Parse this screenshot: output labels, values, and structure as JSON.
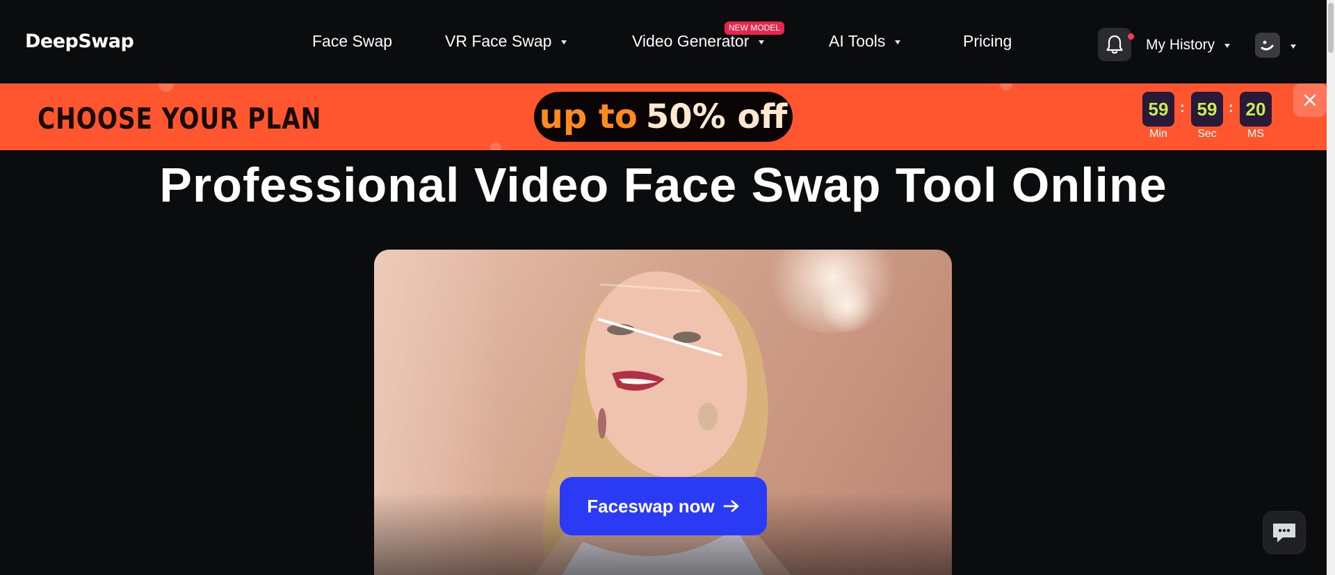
{
  "header": {
    "logo": "DeepSwap",
    "nav": [
      {
        "label": "Face Swap",
        "has_dropdown": false
      },
      {
        "label": "VR Face Swap",
        "has_dropdown": true
      },
      {
        "label": "Video Generator",
        "has_dropdown": true,
        "badge": "NEW MODEL"
      },
      {
        "label": "AI Tools",
        "has_dropdown": true
      },
      {
        "label": "Pricing",
        "has_dropdown": false
      }
    ],
    "notifications_icon": "bell-icon",
    "history_label": "My History",
    "avatar_icon": "avatar-icon"
  },
  "banner": {
    "headline": "CHOOSE YOUR PLAN",
    "offer_prefix": "up to",
    "offer_value": "50% off",
    "timer": [
      {
        "value": "59",
        "label": "Min"
      },
      {
        "value": "59",
        "label": "Sec"
      },
      {
        "value": "20",
        "label": "MS"
      }
    ],
    "close_icon": "close-icon"
  },
  "hero": {
    "title": "Professional Video Face Swap Tool Online",
    "cta_label": "Faceswap now",
    "cta_icon": "arrow-right-icon"
  },
  "chat_icon": "chat-icon",
  "colors": {
    "background": "#0b0c0e",
    "banner": "#ff5630",
    "cta": "#2b3bf5",
    "badge": "#e8264d",
    "timer_digits": "#c8f04a"
  }
}
